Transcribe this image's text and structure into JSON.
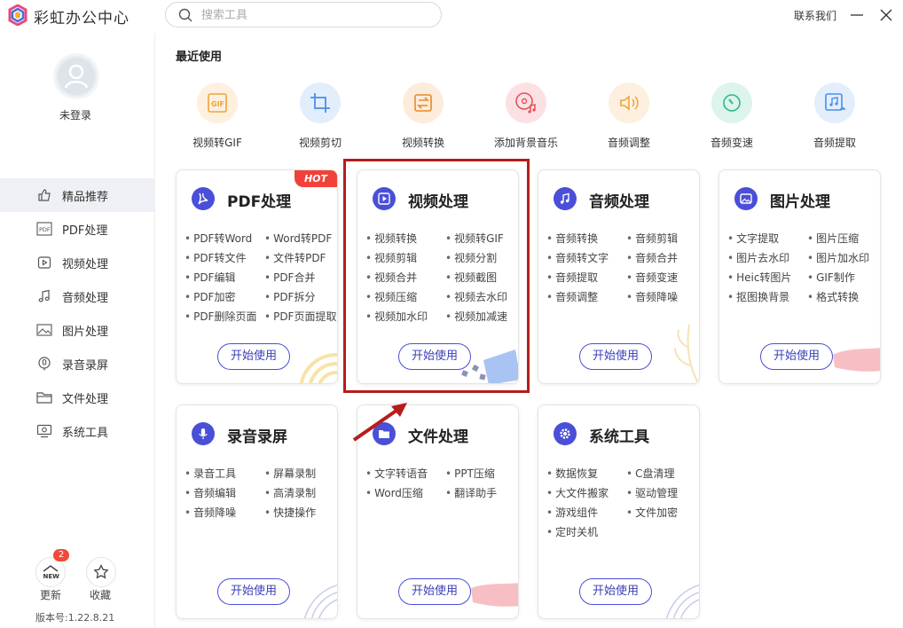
{
  "app": {
    "title": "彩虹办公中心"
  },
  "search": {
    "placeholder": "搜索工具"
  },
  "titlebar": {
    "contact": "联系我们"
  },
  "sidebar": {
    "login_status": "未登录",
    "items": [
      {
        "label": "精品推荐",
        "icon": "thumbs-up-icon",
        "active": true
      },
      {
        "label": "PDF处理",
        "icon": "pdf-icon"
      },
      {
        "label": "视频处理",
        "icon": "video-icon"
      },
      {
        "label": "音频处理",
        "icon": "music-note-icon"
      },
      {
        "label": "图片处理",
        "icon": "image-icon"
      },
      {
        "label": "录音录屏",
        "icon": "microphone-icon"
      },
      {
        "label": "文件处理",
        "icon": "folder-icon"
      },
      {
        "label": "系统工具",
        "icon": "monitor-icon"
      }
    ],
    "update": {
      "label": "更新",
      "badge": "2",
      "icon_text": "NEW"
    },
    "favorite": {
      "label": "收藏"
    },
    "version": "版本号:1.22.8.21"
  },
  "recent": {
    "title": "最近使用",
    "items": [
      {
        "label": "视频转GIF",
        "icon": "gif-icon",
        "color": "#f0a33a"
      },
      {
        "label": "视频剪切",
        "icon": "crop-icon",
        "color": "#4a8fe8"
      },
      {
        "label": "视频转换",
        "icon": "convert-icon",
        "color": "#e8892a"
      },
      {
        "label": "添加背景音乐",
        "icon": "disc-music-icon",
        "color": "#e8505b"
      },
      {
        "label": "音频调整",
        "icon": "speaker-icon",
        "color": "#f0a33a"
      },
      {
        "label": "音频变速",
        "icon": "speed-icon",
        "color": "#2fb68a"
      },
      {
        "label": "音频提取",
        "icon": "extract-audio-icon",
        "color": "#4a8fe8"
      }
    ]
  },
  "cards": {
    "pdf": {
      "title": "PDF处理",
      "hot": "HOT",
      "button": "开始使用",
      "items": [
        "PDF转Word",
        "Word转PDF",
        "PDF转文件",
        "文件转PDF",
        "PDF编辑",
        "PDF合并",
        "PDF加密",
        "PDF拆分",
        "PDF删除页面",
        "PDF页面提取"
      ]
    },
    "video": {
      "title": "视频处理",
      "button": "开始使用",
      "items": [
        "视频转换",
        "视频转GIF",
        "视频剪辑",
        "视频分割",
        "视频合并",
        "视频截图",
        "视频压缩",
        "视频去水印",
        "视频加水印",
        "视频加减速"
      ]
    },
    "audio": {
      "title": "音频处理",
      "button": "开始使用",
      "items": [
        "音频转换",
        "音频剪辑",
        "音频转文字",
        "音频合并",
        "音频提取",
        "音频变速",
        "音频调整",
        "音频降噪"
      ]
    },
    "image": {
      "title": "图片处理",
      "button": "开始使用",
      "items": [
        "文字提取",
        "图片压缩",
        "图片去水印",
        "图片加水印",
        "Heic转图片",
        "GIF制作",
        "抠图换背景",
        "格式转换"
      ]
    },
    "record": {
      "title": "录音录屏",
      "button": "开始使用",
      "items": [
        "录音工具",
        "屏幕录制",
        "音频编辑",
        "高清录制",
        "音频降噪",
        "快捷操作"
      ]
    },
    "file": {
      "title": "文件处理",
      "button": "开始使用",
      "items": [
        "文字转语音",
        "PPT压缩",
        "Word压缩",
        "翻译助手"
      ]
    },
    "system": {
      "title": "系统工具",
      "button": "开始使用",
      "items": [
        "数据恢复",
        "C盘清理",
        "大文件搬家",
        "驱动管理",
        "游戏组件",
        "文件加密",
        "定时关机"
      ]
    }
  },
  "colors": {
    "accent": "#4a4fd8",
    "highlight": "#b71c1c",
    "hot": "#f0423a"
  }
}
